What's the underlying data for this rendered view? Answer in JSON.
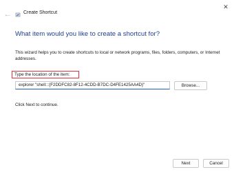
{
  "window": {
    "title": "Create Shortcut",
    "back_glyph": "←",
    "close_glyph": "✕"
  },
  "wizard": {
    "heading": "What item would you like to create a shortcut for?",
    "description": "This wizard helps you to create shortcuts to local or network programs, files, folders, computers, or Internet addresses.",
    "field_label": "Type the location of the item:",
    "location_value": "explorer \"shell:::{F2DDFC82-8F12-4CDD-B7DC-D4FE1425AA4D}\"",
    "browse_label": "Browse...",
    "hint": "Click Next to continue."
  },
  "footer": {
    "next_label": "Next",
    "cancel_label": "Cancel"
  },
  "colors": {
    "heading": "#1d3f8f",
    "highlight_box": "#e0303a",
    "input_underline": "#1f5fbf"
  },
  "icons": {
    "back": "back-arrow-icon",
    "app": "shortcut-app-icon",
    "close": "close-icon"
  }
}
